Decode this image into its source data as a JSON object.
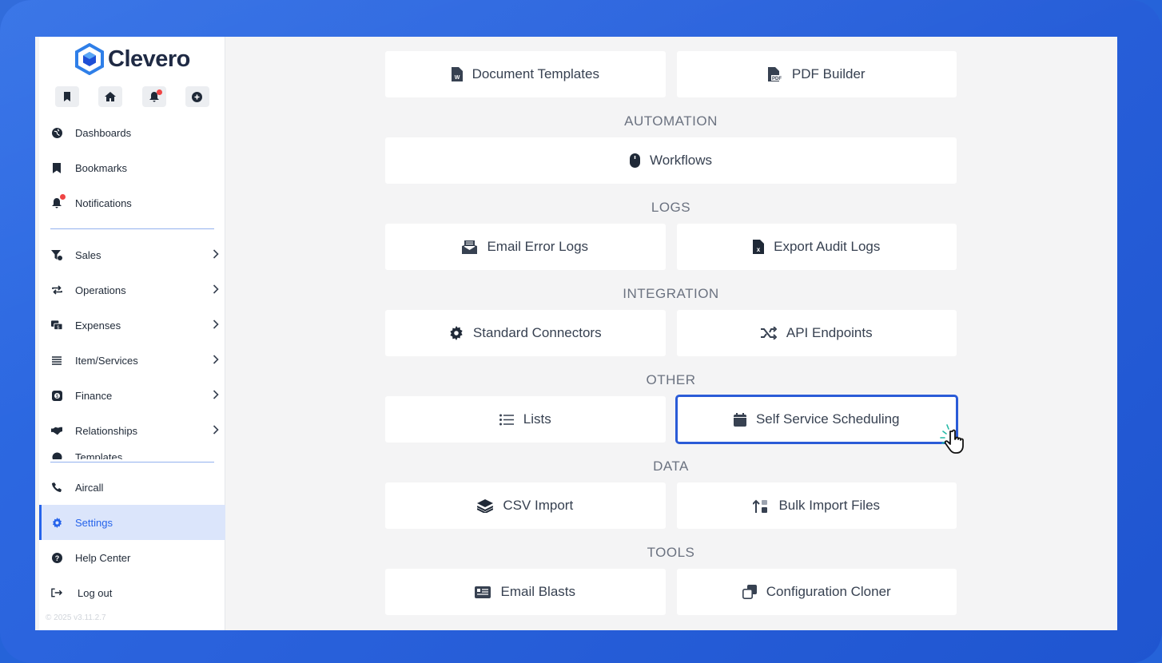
{
  "brand": {
    "name": "Clevero",
    "accent": "#2563eb"
  },
  "sidebar": {
    "quick_actions": [
      {
        "icon": "bookmark-icon"
      },
      {
        "icon": "home-icon"
      },
      {
        "icon": "bell-icon",
        "badge": true
      },
      {
        "icon": "plus-circle-icon"
      }
    ],
    "top_items": [
      {
        "label": "Dashboards",
        "icon": "globe-icon"
      },
      {
        "label": "Bookmarks",
        "icon": "bookmark-icon"
      },
      {
        "label": "Notifications",
        "icon": "bell-icon"
      }
    ],
    "group_items": [
      {
        "label": "Sales",
        "icon": "funnel-icon"
      },
      {
        "label": "Operations",
        "icon": "repeat-icon"
      },
      {
        "label": "Expenses",
        "icon": "money-icon"
      },
      {
        "label": "Item/Services",
        "icon": "list-icon"
      },
      {
        "label": "Finance",
        "icon": "finance-icon"
      },
      {
        "label": "Relationships",
        "icon": "handshake-icon"
      }
    ],
    "partial_item": "Templates",
    "bottom_items": [
      {
        "label": "Aircall",
        "icon": "phone-icon"
      },
      {
        "label": "Settings",
        "icon": "gear-icon",
        "active": true
      },
      {
        "label": "Help Center",
        "icon": "help-icon"
      },
      {
        "label": "Log out",
        "icon": "logout-icon"
      }
    ],
    "version": "© 2025  v3.11.2.7"
  },
  "main": {
    "sections": {
      "automation": "AUTOMATION",
      "logs": "LOGS",
      "integration": "INTEGRATION",
      "other": "OTHER",
      "data": "DATA",
      "tools": "TOOLS"
    },
    "cards": {
      "document_templates": "Document Templates",
      "pdf_builder": "PDF Builder",
      "workflows": "Workflows",
      "email_error_logs": "Email Error Logs",
      "export_audit_logs": "Export Audit Logs",
      "standard_connectors": "Standard Connectors",
      "api_endpoints": "API Endpoints",
      "lists": "Lists",
      "self_service_scheduling": "Self Service Scheduling",
      "csv_import": "CSV Import",
      "bulk_import_files": "Bulk Import Files",
      "email_blasts": "Email Blasts",
      "configuration_cloner": "Configuration Cloner"
    }
  }
}
